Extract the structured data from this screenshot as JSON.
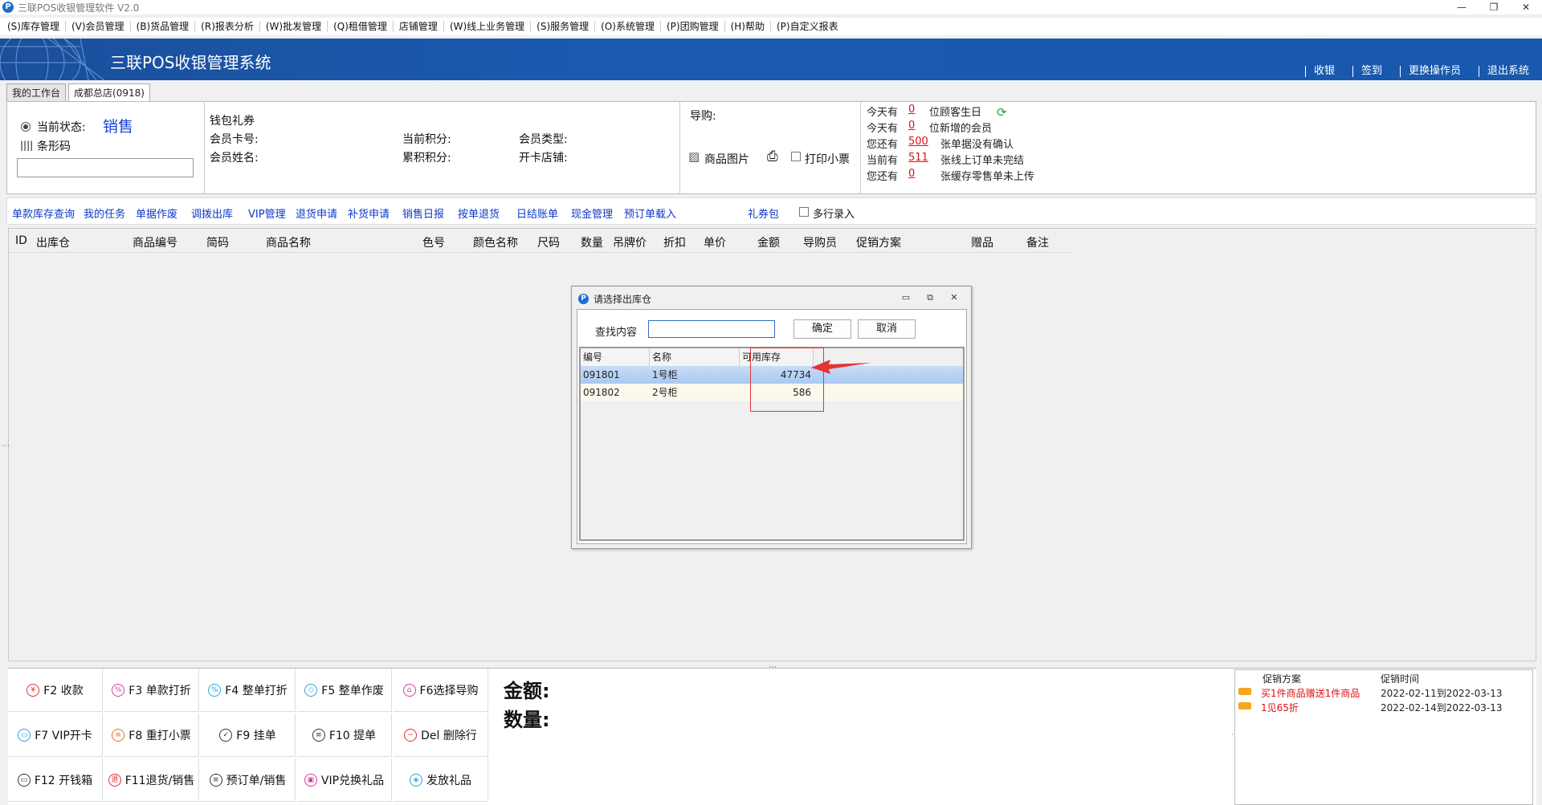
{
  "window": {
    "title": "三联POS收银管理软件 V2.0",
    "logo": "P",
    "controls": [
      "—",
      "❐",
      "✕"
    ]
  },
  "menu": [
    "(S)库存管理",
    "(V)会员管理",
    "(B)货品管理",
    "(R)报表分析",
    "(W)批发管理",
    "(Q)租借管理",
    "店铺管理",
    "(W)线上业务管理",
    "(S)服务管理",
    "(O)系统管理",
    "(P)团购管理",
    "(H)帮助",
    "(P)自定义报表"
  ],
  "banner": {
    "system_name": "三联POS收银管理系统",
    "actions": [
      "收银",
      "签到",
      "更换操作员",
      "退出系统"
    ]
  },
  "tabs": [
    "我的工作台",
    "成都总店(0918)"
  ],
  "info": {
    "status_label": "当前状态:",
    "status_value": "销售",
    "barcode_label": "条形码",
    "wallet_coupon": "钱包礼券",
    "member_card": "会员卡号:",
    "member_name": "会员姓名:",
    "current_points": "当前积分:",
    "accum_points": "累积积分:",
    "member_type": "会员类型:",
    "card_store": "开卡店铺:",
    "guide": "导购:",
    "product_image": "商品图片",
    "print_receipt": "打印小票",
    "notices": [
      {
        "prefix": "今天有",
        "value": "0",
        "suffix": "位顾客生日"
      },
      {
        "prefix": "今天有",
        "value": "0",
        "suffix": "位新增的会员"
      },
      {
        "prefix": "您还有",
        "value": "500",
        "suffix": "张单据没有确认"
      },
      {
        "prefix": "当前有",
        "value": "511",
        "suffix": "张线上订单未完结"
      },
      {
        "prefix": "您还有",
        "value": "0",
        "suffix": "张缓存零售单未上传"
      }
    ]
  },
  "funcbar": {
    "links": [
      "单款库存查询",
      "我的任务",
      "单据作废",
      "调拨出库",
      "VIP管理",
      "退货申请",
      "补货申请",
      "销售日报",
      "按单退货",
      "日结账单",
      "现金管理",
      "预订单载入",
      "礼券包"
    ],
    "multi_entry": "多行录入"
  },
  "grid": {
    "columns": [
      "ID",
      "出库仓",
      "商品编号",
      "简码",
      "商品名称",
      "色号",
      "颜色名称",
      "尺码",
      "数量",
      "吊牌价",
      "折扣",
      "单价",
      "金额",
      "导购员",
      "促销方案",
      "赠品",
      "备注"
    ]
  },
  "dialog": {
    "title": "请选择出库仓",
    "search_label": "查找内容",
    "search_value": "",
    "ok": "确定",
    "cancel": "取消",
    "headers": [
      "编号",
      "名称",
      "可用库存"
    ],
    "rows": [
      {
        "code": "091801",
        "name": "1号柜",
        "stock": "47734"
      },
      {
        "code": "091802",
        "name": "2号柜",
        "stock": "586"
      }
    ]
  },
  "fkeys": [
    {
      "label": "F2 收款",
      "icon": "yuan-icon",
      "glyph": "¥",
      "color": "#e03030"
    },
    {
      "label": "F3 单款打折",
      "icon": "percent-icon",
      "glyph": "%",
      "color": "#d63aa0"
    },
    {
      "label": "F4 整单打折",
      "icon": "percent-icon",
      "glyph": "%",
      "color": "#2aa6d8"
    },
    {
      "label": "F5 整单作废",
      "icon": "void-icon",
      "glyph": "◇",
      "color": "#2aa6d8"
    },
    {
      "label": "F6选择导购",
      "icon": "guide-icon",
      "glyph": "⌂",
      "color": "#d63aa0"
    },
    {
      "label": "F7 VIP开卡",
      "icon": "card-icon",
      "glyph": "▭",
      "color": "#2aa6d8"
    },
    {
      "label": "F8 重打小票",
      "icon": "reprint-icon",
      "glyph": "≡",
      "color": "#e07030"
    },
    {
      "label": "F9 挂单",
      "icon": "clipboard-icon",
      "glyph": "✓",
      "color": "#333333"
    },
    {
      "label": "F10 提单",
      "icon": "document-icon",
      "glyph": "≡",
      "color": "#333333"
    },
    {
      "label": "Del 删除行",
      "icon": "delete-icon",
      "glyph": "−",
      "color": "#e03030"
    },
    {
      "label": "F12 开钱箱",
      "icon": "cashbox-icon",
      "glyph": "▭",
      "color": "#333333"
    },
    {
      "label": "F11退货/销售",
      "icon": "return-icon",
      "glyph": "退",
      "color": "#e03030"
    },
    {
      "label": "预订单/销售",
      "icon": "order-icon",
      "glyph": "≡",
      "color": "#333333"
    },
    {
      "label": "VIP兑换礼品",
      "icon": "gift-icon",
      "glyph": "▣",
      "color": "#d63aa0"
    },
    {
      "label": "发放礼品",
      "icon": "ticket-icon",
      "glyph": "◈",
      "color": "#2aa6d8"
    }
  ],
  "totals": {
    "amount_label": "金额:",
    "qty_label": "数量:"
  },
  "promo": {
    "headers": [
      "促销方案",
      "促销时间"
    ],
    "rows": [
      {
        "name": "买1件商品赠送1件商品",
        "time": "2022-02-11到2022-03-13"
      },
      {
        "name": "1见65折",
        "time": "2022-02-14到2022-03-13"
      }
    ]
  }
}
